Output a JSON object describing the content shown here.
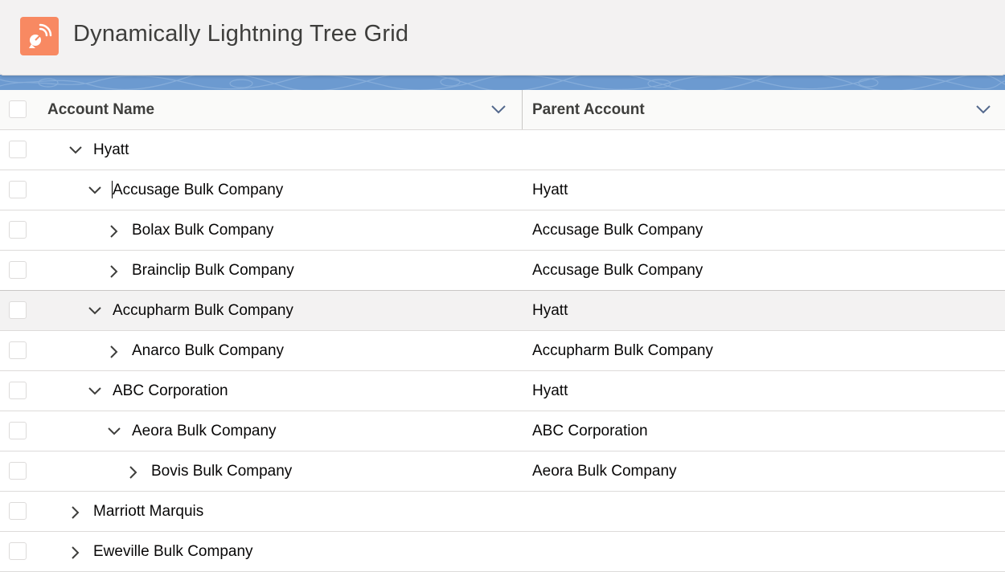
{
  "header": {
    "title": "Dynamically Lightning Tree Grid",
    "icon": "broadcast-dish-icon",
    "icon_color": "#f88962"
  },
  "grid": {
    "columns": [
      {
        "label": "Account Name"
      },
      {
        "label": "Parent Account"
      }
    ],
    "rows": [
      {
        "name": "Hyatt",
        "parent": "",
        "level": 1,
        "expanded": true
      },
      {
        "name": "Accusage Bulk Company",
        "parent": "Hyatt",
        "level": 2,
        "expanded": true
      },
      {
        "name": "Bolax Bulk Company",
        "parent": "Accusage Bulk Company",
        "level": 3,
        "expanded": false
      },
      {
        "name": "Brainclip Bulk Company",
        "parent": "Accusage Bulk Company",
        "level": 3,
        "expanded": false
      },
      {
        "name": "Accupharm Bulk Company",
        "parent": "Hyatt",
        "level": 2,
        "expanded": true
      },
      {
        "name": "Anarco Bulk Company",
        "parent": "Accupharm Bulk Company",
        "level": 3,
        "expanded": false
      },
      {
        "name": "ABC Corporation",
        "parent": "Hyatt",
        "level": 2,
        "expanded": true
      },
      {
        "name": "Aeora Bulk Company",
        "parent": "ABC Corporation",
        "level": 3,
        "expanded": true
      },
      {
        "name": "Bovis Bulk Company",
        "parent": "Aeora Bulk Company",
        "level": 4,
        "expanded": false
      },
      {
        "name": "Marriott Marquis",
        "parent": "",
        "level": 1,
        "expanded": false
      },
      {
        "name": "Eweville Bulk Company",
        "parent": "",
        "level": 1,
        "expanded": false
      }
    ]
  }
}
